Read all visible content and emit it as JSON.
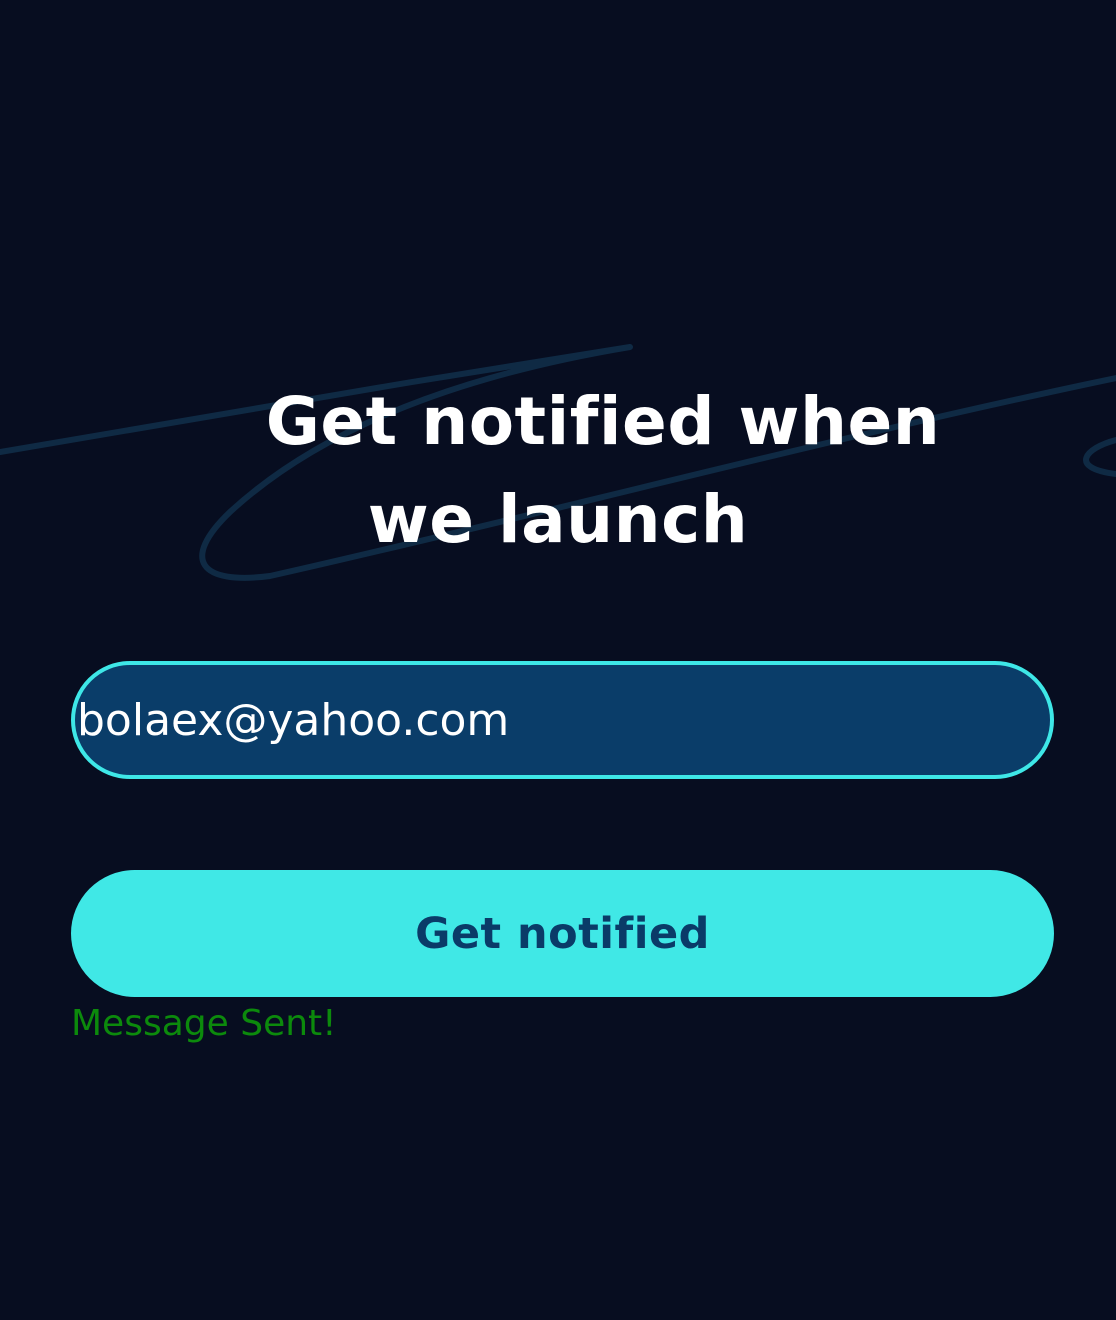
{
  "headline": {
    "line1": "Get notified when",
    "line2": "we launch"
  },
  "email_field": {
    "value": "bolaex@yahoo.com"
  },
  "submit_button": {
    "label": "Get notified"
  },
  "status": {
    "text": "Message Sent!",
    "color": "#0c8a0c"
  },
  "colors": {
    "background": "#070d20",
    "accent": "#40e8e6",
    "input_fill": "#0a3d69",
    "button_text": "#0a3b68"
  }
}
